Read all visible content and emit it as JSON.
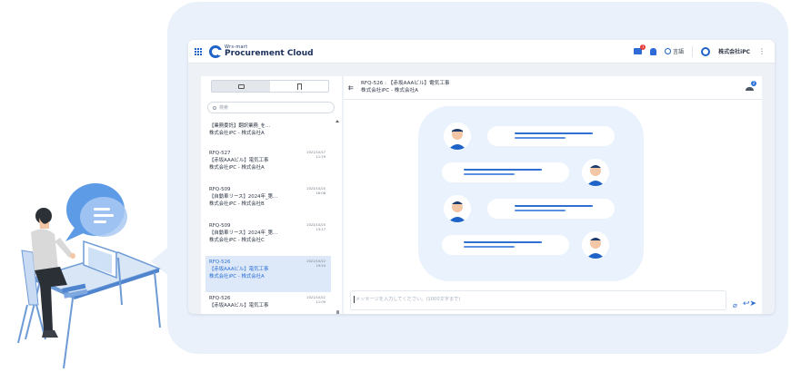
{
  "brand": {
    "sub": "Wrs-mart",
    "name": "Procurement Cloud"
  },
  "header": {
    "chat_badge": "1",
    "language_label": "言語",
    "company_name": "株式会社iPC"
  },
  "search": {
    "placeholder": "検索"
  },
  "conversations": [
    {
      "title": "【業務委託】翻訳業務_を…",
      "company": "株式会社iPC - 株式会社A",
      "date": ""
    },
    {
      "id": "RFQ-527",
      "title": "【赤坂AAAビル】電気工事",
      "company": "株式会社iPC - 株式会社A",
      "date": "2021/10/27 11:29"
    },
    {
      "id": "RFQ-509",
      "title": "【自動車リース】2024年_第…",
      "company": "株式会社iPC - 株式会社B",
      "date": "2023/10/20 16:08"
    },
    {
      "id": "RFQ-509",
      "title": "【自動車リース】2024年_第…",
      "company": "株式会社iPC - 株式会社C",
      "date": "2023/10/25 13:17"
    },
    {
      "id": "RFQ-526",
      "title": "【赤坂AAAビル】電気工事",
      "company": "株式会社iPC - 株式会社A",
      "date": "2021/10/22 19:24",
      "selected": true
    },
    {
      "id": "RFQ-526",
      "title": "【赤坂AAAビル】電気工事",
      "company": "",
      "date": "2021/10/22 11:09"
    }
  ],
  "thread": {
    "title": "RFQ-526 : 【赤坂AAAビル】電気工事",
    "subtitle": "株式会社iPC - 株式会社A",
    "member_count": "2"
  },
  "composer": {
    "placeholder": "メッセージを入力してください。(1000文字まで)"
  },
  "colors": {
    "accent": "#1f63c8",
    "card_bg": "#eaf1fa",
    "selected_bg": "#dde9f8",
    "badge_red": "#e53935"
  },
  "icons": [
    "apps-grid-icon",
    "brand-logo-icon",
    "chat-icon",
    "bell-icon",
    "globe-icon",
    "company-logo-icon",
    "kebab-icon",
    "message-tab-icon",
    "bookmark-tab-icon",
    "search-icon",
    "collapse-icon",
    "members-icon",
    "attach-icon",
    "send-icon"
  ]
}
